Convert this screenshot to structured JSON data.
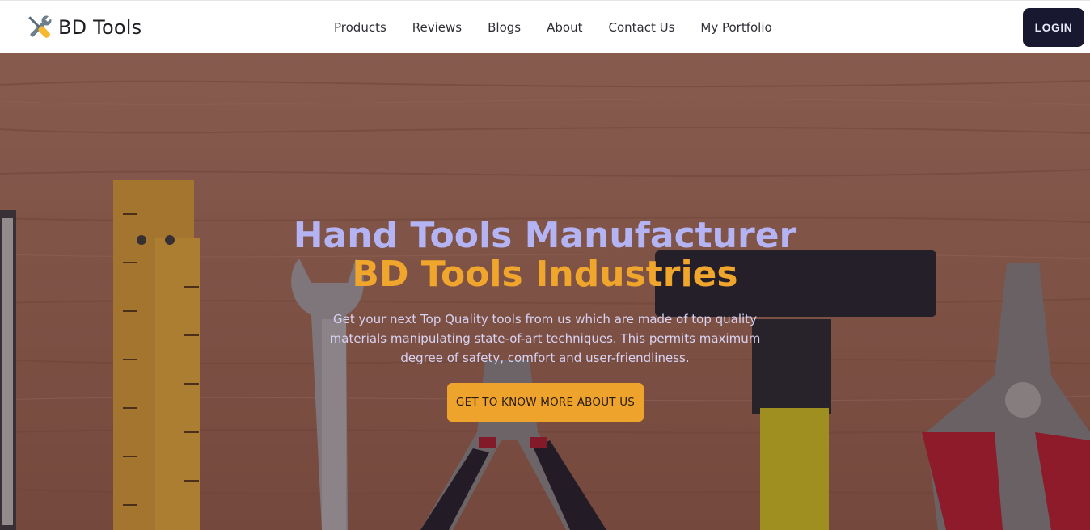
{
  "brand": {
    "name": "BD Tools",
    "logo_icon": "tools-icon"
  },
  "nav": {
    "items": [
      {
        "label": "Products"
      },
      {
        "label": "Reviews"
      },
      {
        "label": "Blogs"
      },
      {
        "label": "About"
      },
      {
        "label": "Contact Us"
      },
      {
        "label": "My Portfolio"
      }
    ],
    "login_label": "LOGIN"
  },
  "hero": {
    "title": "Hand Tools Manufacturer",
    "subtitle": "BD Tools Industries",
    "description": "Get your next Top Quality tools from us which are made of top quality materials manipulating state-of-art techniques. This permits maximum degree of safety, comfort and user-friendliness.",
    "cta_label": "GET TO KNOW MORE ABOUT US"
  },
  "colors": {
    "title": "#b4b4f4",
    "subtitle": "#f0a52c",
    "cta_bg": "#eea42c",
    "login_bg": "#181830"
  }
}
